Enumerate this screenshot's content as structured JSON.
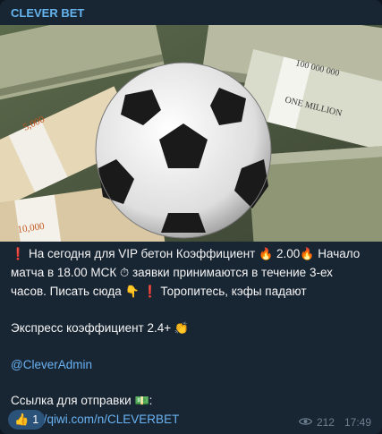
{
  "channel": {
    "name": "CLEVER BET"
  },
  "post": {
    "line1": {
      "icon_exclaim": "❗",
      "a": " На сегодня для VIP бетон Коэффициент ",
      "icon_fire": "🔥",
      "b": " 2.00",
      "c": " Начало"
    },
    "line2": {
      "a": "матча  в 18.00 МСК ",
      "icon_clock": "⏱",
      "b": " заявки принимаются в течение 3-ех"
    },
    "line3": {
      "a": "часов. Писать сюда ",
      "icon_point": "👇",
      "b": " ",
      "icon_exclaim": "❗",
      "c": " Торопитесь, кэфы падают"
    },
    "express": {
      "text": "Экспресс коэффициент 2.4+ ",
      "icon_clap": "👏"
    },
    "mention": "@CleverAdmin",
    "payment": {
      "label": "Ссылка для отправки ",
      "icon_money": "💵",
      "colon": ":",
      "url": "https://qiwi.com/n/CLEVERBET"
    }
  },
  "reaction": {
    "emoji": "👍",
    "count": "1"
  },
  "meta": {
    "views": "212",
    "time": "17:49"
  },
  "colors": {
    "accent": "#64b5ef",
    "link": "#6ab3f3",
    "bubble": "#182533",
    "reaction_bg": "#2b5278"
  }
}
